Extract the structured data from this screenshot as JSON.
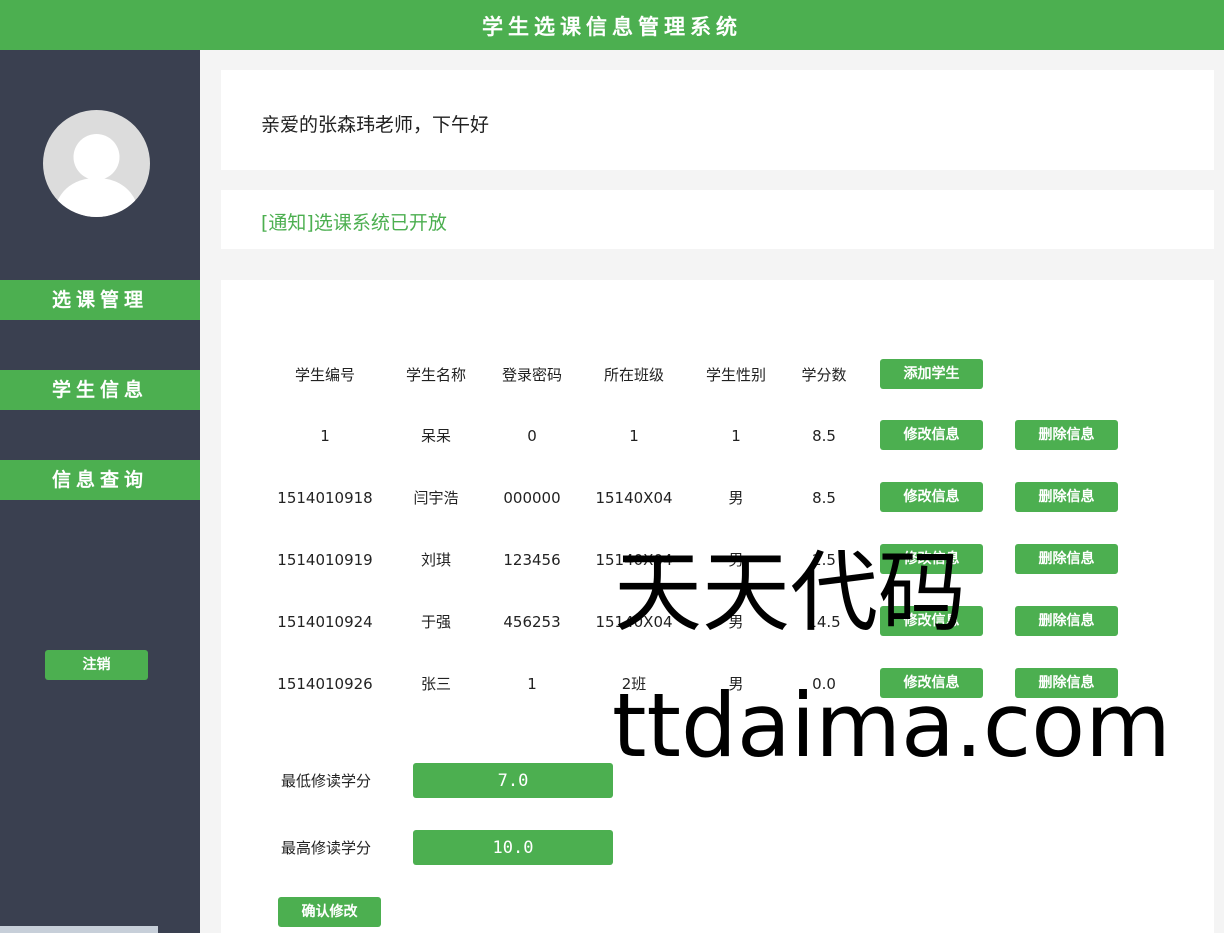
{
  "header": {
    "title": "学生选课信息管理系统"
  },
  "sidebar": {
    "avatar_icon": "user-avatar-icon",
    "items": [
      {
        "label": "选课管理"
      },
      {
        "label": "学生信息"
      },
      {
        "label": "信息查询"
      }
    ],
    "logout_label": "注销"
  },
  "greeting": {
    "text": "亲爱的张森玮老师，下午好"
  },
  "notice": {
    "text": "[通知]选课系统已开放"
  },
  "table": {
    "headers": [
      "学生编号",
      "学生名称",
      "登录密码",
      "所在班级",
      "学生性别",
      "学分数"
    ],
    "add_button": "添加学生",
    "edit_button": "修改信息",
    "delete_button": "删除信息",
    "rows": [
      [
        "1",
        "呆呆",
        "0",
        "1",
        "1",
        "8.5"
      ],
      [
        "1514010918",
        "闫宇浩",
        "000000",
        "15140X04",
        "男",
        "8.5"
      ],
      [
        "1514010919",
        "刘琪",
        "123456",
        "15140X04",
        "男",
        "2.5"
      ],
      [
        "1514010924",
        "于强",
        "456253",
        "15140X04",
        "男",
        "14.5"
      ],
      [
        "1514010926",
        "张三",
        "1",
        "2班",
        "男",
        "0.0"
      ]
    ]
  },
  "credits": {
    "min_label": "最低修读学分",
    "min_value": "7.0",
    "max_label": "最高修读学分",
    "max_value": "10.0",
    "confirm_label": "确认修改"
  },
  "watermark": {
    "line1": "天天代码",
    "line2": "ttdaima.com"
  },
  "colors": {
    "accent": "#4caf50",
    "sidebar": "#3a4050",
    "page_bg": "#f4f4f4"
  }
}
